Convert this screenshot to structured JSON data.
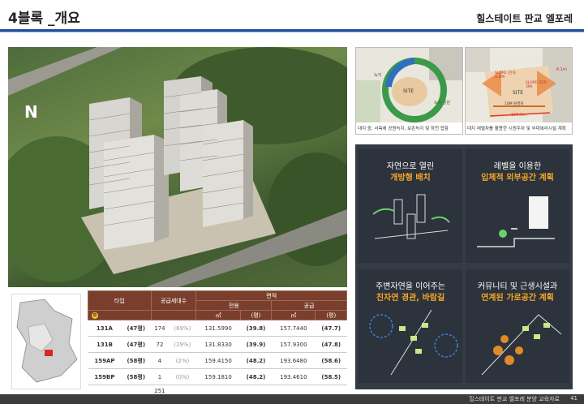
{
  "header": {
    "title": "4블록 _개요",
    "brand": "힐스테이트 판교 엘포레"
  },
  "compass": {
    "label": "N"
  },
  "diagrams": [
    {
      "caption": "대지 중, 서측에 공원녹지, 보존녹지 및 하천 접함",
      "labels": {
        "site": "SITE",
        "green_left": "녹지",
        "green_right": "녹지 공원"
      }
    },
    {
      "caption": "대지 레벨차를 활용한 시원주차 및 부대복리시설 계획",
      "labels": {
        "slope1": "SLOPE (단차: 3.2M)",
        "slope2": "SLOPE (단차: 3M)",
        "height": "6.1m",
        "site": "SITE",
        "dist": "10M 원경차",
        "width": "159.0m"
      }
    }
  ],
  "concepts": [
    {
      "line1": "자연으로 열린",
      "line2": "개방형 배치"
    },
    {
      "line1": "레벨을 이용한",
      "line2": "입체적 외부공간 계획"
    },
    {
      "line1": "주변자연을 이어주는",
      "line2": "친자연 경관, 바람길"
    },
    {
      "line1": "커뮤니티 및 근생시설과",
      "line2": "연계된 가로공간 계획"
    }
  ],
  "table": {
    "headers": {
      "type": "타입",
      "units": "공급세대수",
      "area": "면적",
      "exclusive": "전용",
      "supply": "공급",
      "sqm": "㎡",
      "pyeong": "(평)"
    },
    "marker": "D",
    "rows": [
      {
        "type": "131A",
        "py": "(47평)",
        "units": "174",
        "pct": "(69%)",
        "excl": "131.5990",
        "excl_py": "(39.8)",
        "supply": "157.7440",
        "supply_py": "(47.7)"
      },
      {
        "type": "131B",
        "py": "(47평)",
        "units": "72",
        "pct": "(29%)",
        "excl": "131.8330",
        "excl_py": "(39.9)",
        "supply": "157.9300",
        "supply_py": "(47.8)"
      },
      {
        "type": "159AP",
        "py": "(58평)",
        "units": "4",
        "pct": "(2%)",
        "excl": "159.4150",
        "excl_py": "(48.2)",
        "supply": "193.6480",
        "supply_py": "(58.6)"
      },
      {
        "type": "159BP",
        "py": "(58평)",
        "units": "1",
        "pct": "(0%)",
        "excl": "159.1810",
        "excl_py": "(48.2)",
        "supply": "193.4610",
        "supply_py": "(58.5)"
      }
    ],
    "total": "251"
  },
  "footer": {
    "text": "힐스테이트 판교 엘포레 분양 교육자료",
    "page": "41"
  }
}
